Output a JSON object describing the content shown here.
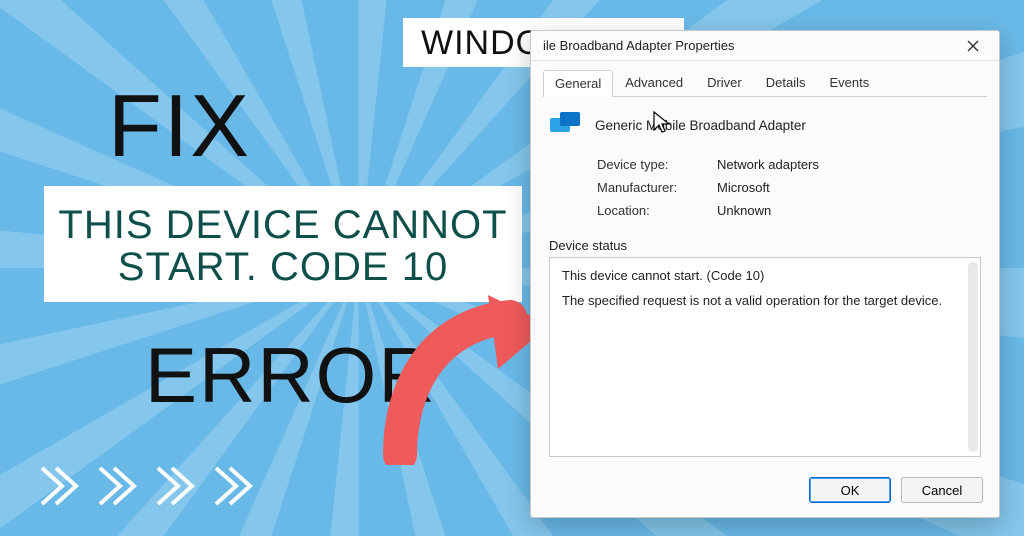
{
  "promo": {
    "badge": "WINDOWS FIX",
    "fix": "FIX",
    "msg_line1": "THIS DEVICE CANNOT",
    "msg_line2": "START. CODE 10",
    "error": "ERROR"
  },
  "dialog": {
    "title": "ile Broadband Adapter Properties",
    "tabs": {
      "general": "General",
      "advanced": "Advanced",
      "driver": "Driver",
      "details": "Details",
      "events": "Events"
    },
    "device_name": "Generic Mobile Broadband Adapter",
    "labels": {
      "type": "Device type:",
      "mfr": "Manufacturer:",
      "loc": "Location:",
      "status_group": "Device status"
    },
    "values": {
      "type": "Network adapters",
      "mfr": "Microsoft",
      "loc": "Unknown"
    },
    "status": {
      "line1": "This device cannot start. (Code 10)",
      "line2": "The specified request is not a valid operation for the target device."
    },
    "buttons": {
      "ok": "OK",
      "cancel": "Cancel"
    }
  }
}
